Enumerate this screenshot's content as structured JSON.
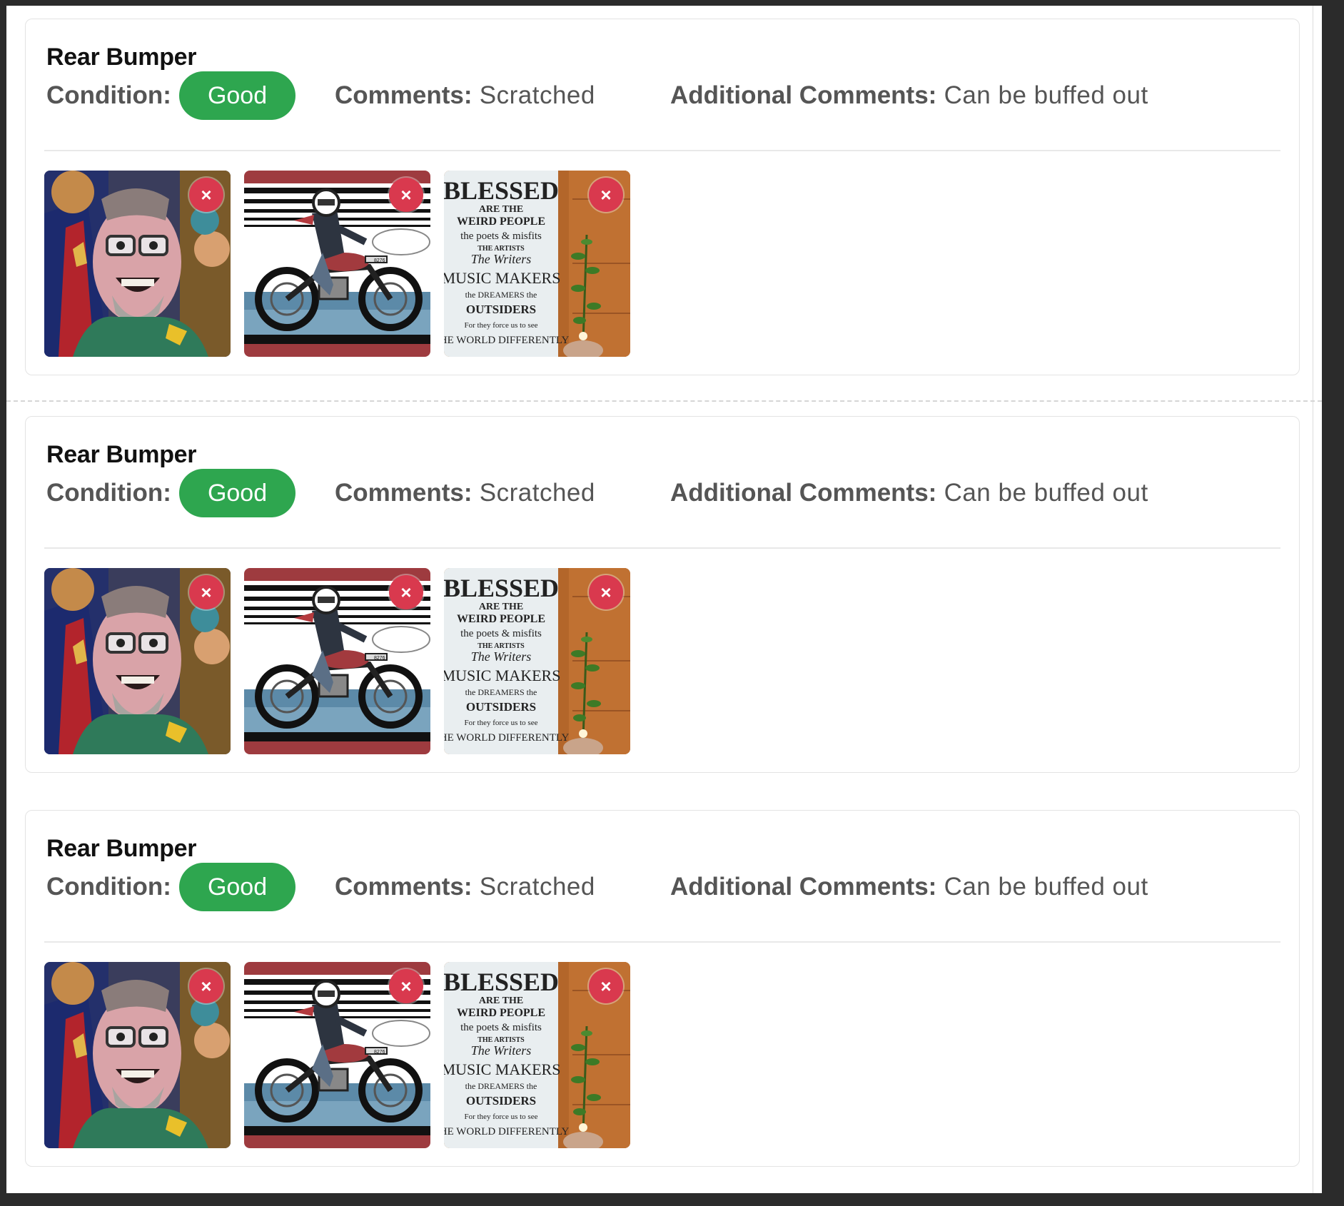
{
  "damage_items": [
    {
      "title": "Rear Bumper",
      "condition_label": "Condition:",
      "condition_value": "Good",
      "comments_label": "Comments:",
      "comments_value": "Scratched",
      "additional_label": "Additional Comments:",
      "additional_value": "Can be buffed out",
      "photos": [
        {
          "name": "portrait-photo",
          "remove_label": "×"
        },
        {
          "name": "motorcycle-photo",
          "remove_label": "×"
        },
        {
          "name": "blessed-sign-photo",
          "remove_label": "×"
        }
      ]
    },
    {
      "title": "Rear Bumper",
      "condition_label": "Condition:",
      "condition_value": "Good",
      "comments_label": "Comments:",
      "comments_value": "Scratched",
      "additional_label": "Additional Comments:",
      "additional_value": "Can be buffed out",
      "photos": [
        {
          "name": "portrait-photo",
          "remove_label": "×"
        },
        {
          "name": "motorcycle-photo",
          "remove_label": "×"
        },
        {
          "name": "blessed-sign-photo",
          "remove_label": "×"
        }
      ]
    },
    {
      "title": "Rear Bumper",
      "condition_label": "Condition:",
      "condition_value": "Good",
      "comments_label": "Comments:",
      "comments_value": "Scratched",
      "additional_label": "Additional Comments:",
      "additional_value": "Can be buffed out",
      "photos": [
        {
          "name": "portrait-photo",
          "remove_label": "×"
        },
        {
          "name": "motorcycle-photo",
          "remove_label": "×"
        },
        {
          "name": "blessed-sign-photo",
          "remove_label": "×"
        }
      ]
    }
  ],
  "colors": {
    "badge_good": "#2ea64f",
    "remove_button": "#d9394e",
    "label_text": "#555555"
  },
  "sign_text": {
    "line1": "BLESSED",
    "line2": "ARE THE",
    "line3": "WEIRD PEOPLE",
    "line4": "the poets & misfits",
    "line5": "THE ARTISTS",
    "line6": "The Writers",
    "line7": "MUSIC MAKERS",
    "line8": "the DREAMERS the",
    "line9": "OUTSIDERS",
    "line10": "For they force us to see",
    "line11": "THE WORLD DIFFERENTLY"
  },
  "plate_text": "8276"
}
